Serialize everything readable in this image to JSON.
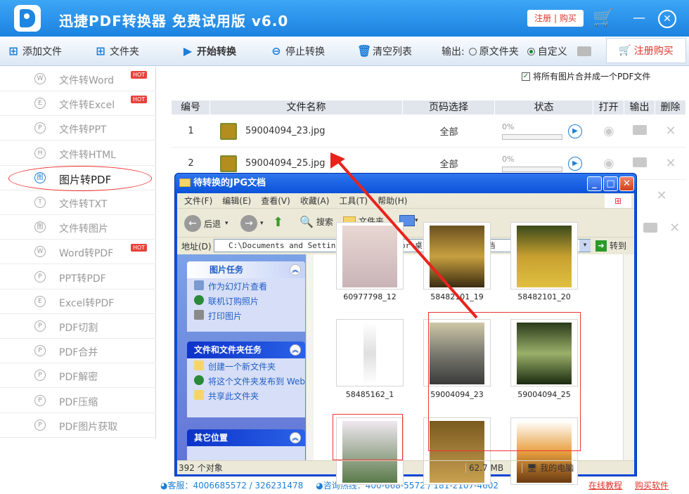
{
  "app": {
    "title": "迅捷PDF转换器 免费试用版 v6.0",
    "reg_link": "注册 | 购买"
  },
  "toolbar": {
    "add_file": "添加文件",
    "folder": "文件夹",
    "start": "开始转换",
    "stop": "停止转换",
    "clear": "清空列表",
    "output_label": "输出:",
    "output_src": "原文件夹",
    "output_custom": "自定义",
    "buy": "注册购买"
  },
  "sidebar": {
    "items": [
      {
        "label": "文件转Word",
        "hot": "HOT",
        "icon": "W"
      },
      {
        "label": "文件转Excel",
        "hot": "HOT",
        "icon": "E"
      },
      {
        "label": "文件转PPT",
        "icon": "P"
      },
      {
        "label": "文件转HTML",
        "icon": "H"
      },
      {
        "label": "图片转PDF",
        "icon": "图"
      },
      {
        "label": "文件转TXT",
        "icon": "T"
      },
      {
        "label": "文件转图片",
        "icon": "图"
      },
      {
        "label": "Word转PDF",
        "hot": "HOT",
        "icon": "W"
      },
      {
        "label": "PPT转PDF",
        "icon": "P"
      },
      {
        "label": "Excel转PDF",
        "icon": "E"
      },
      {
        "label": "PDF切割",
        "icon": "P"
      },
      {
        "label": "PDF合并",
        "icon": "P"
      },
      {
        "label": "PDF解密",
        "icon": "P"
      },
      {
        "label": "PDF压缩",
        "icon": "P"
      },
      {
        "label": "PDF图片获取",
        "icon": "P"
      }
    ],
    "active_index": 4
  },
  "main": {
    "merge_option": "将所有图片合并成一个PDF文件",
    "merge_checked": true,
    "columns": [
      "编号",
      "文件名称",
      "页码选择",
      "状态",
      "打开",
      "输出",
      "删除"
    ],
    "rows": [
      {
        "num": "1",
        "name": "59004094_23.jpg",
        "pages": "全部",
        "progress": "0%"
      },
      {
        "num": "2",
        "name": "59004094_25.jpg",
        "pages": "全部",
        "progress": "0%"
      }
    ]
  },
  "status": {
    "qq": "客服：4006685572 / 326231478",
    "hotline": "咨询热线：400-668-5572 / 181-2107-4602",
    "tutorial": "在线教程",
    "buy": "购买软件"
  },
  "explorer": {
    "title": "待转换的JPG文档",
    "menu": [
      "文件(F)",
      "编辑(E)",
      "查看(V)",
      "收藏(A)",
      "工具(T)",
      "帮助(H)"
    ],
    "back": "后退",
    "search": "搜索",
    "folders": "文件夹",
    "address_label": "地址(D)",
    "address": "C:\\Documents and Settings\\Administrator\\桌面\\待转换的JPG文档",
    "go": "转到",
    "picture_tasks": {
      "title": "图片任务",
      "items": [
        "作为幻灯片查看",
        "联机订购照片",
        "打印图片"
      ]
    },
    "file_tasks": {
      "title": "文件和文件夹任务",
      "items": [
        "创建一个新文件夹",
        "将这个文件夹发布到 Web",
        "共享此文件夹"
      ]
    },
    "other_places": {
      "title": "其它位置"
    },
    "files": [
      "60977798_12",
      "58482101_19",
      "58482101_20",
      "58485162_1",
      "59004094_23",
      "59004094_25"
    ],
    "status_count": "392 个对象",
    "status_size": "62.7 MB",
    "status_location": "我的电脑"
  }
}
